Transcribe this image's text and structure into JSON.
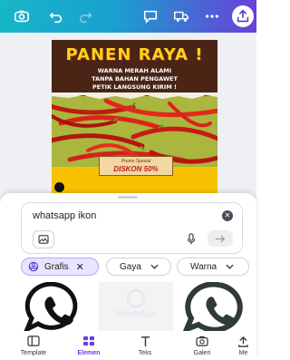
{
  "toolbar": {
    "icons": [
      "home-icon",
      "undo-icon",
      "redo-icon",
      "comment-icon",
      "delivery-truck-icon",
      "more-icon",
      "share-icon"
    ]
  },
  "poster": {
    "title": "PANEN RAYA !",
    "subtitle_line1": "WARNA MERAH ALAMI",
    "subtitle_line2": "TANPA BAHAN PENGAWET",
    "subtitle_line3": "PETIK LANGSUNG KIRIM !",
    "discount_small": "Promo Spesial",
    "discount_big": "DISKON 50%"
  },
  "search": {
    "value": "whatsapp ikon"
  },
  "filters": {
    "grafis": "Grafis",
    "gaya": "Gaya",
    "warna": "Warna"
  },
  "results": {
    "watermark": "WhatsApp"
  },
  "nav": {
    "items": [
      {
        "label": "Template",
        "icon": "template-icon"
      },
      {
        "label": "Elemen",
        "icon": "elements-icon"
      },
      {
        "label": "Teks",
        "icon": "text-icon"
      },
      {
        "label": "Galeri",
        "icon": "camera-icon"
      },
      {
        "label": "Me",
        "icon": "upload-icon"
      }
    ],
    "active": "Elemen"
  },
  "colors": {
    "accent": "#6a3fd8",
    "toolbar_start": "#17b6c8",
    "poster_yellow": "#f7c200"
  }
}
